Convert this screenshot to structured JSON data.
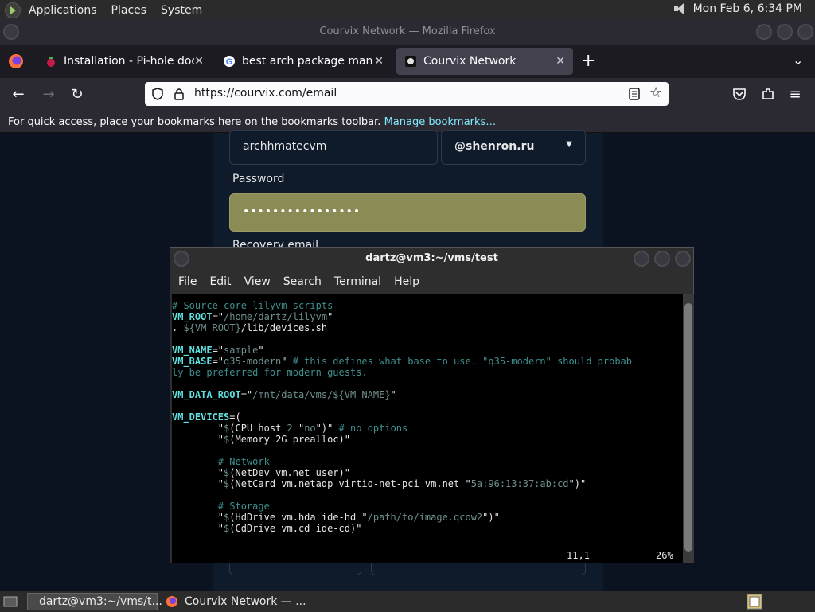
{
  "top_panel": {
    "menus": [
      "Applications",
      "Places",
      "System"
    ],
    "clock": "Mon Feb  6,  6:34 PM"
  },
  "firefox": {
    "window_title": "Courvix Network — Mozilla Firefox",
    "tabs": [
      {
        "title": "Installation - Pi-hole documentation",
        "favicon": "raspberry-icon",
        "color": "#c51a4a"
      },
      {
        "title": "best arch package manager",
        "favicon": "google-icon",
        "color": "#4285f4"
      },
      {
        "title": "Courvix Network",
        "favicon": "courvix-icon",
        "color": "#e0e0e0"
      }
    ],
    "url": "https://courvix.com/email",
    "bookmarks_text": "For quick access, place your bookmarks here on the bookmarks toolbar.",
    "bookmarks_link": "Manage bookmarks…"
  },
  "page": {
    "username_value": "archhmatecvm",
    "domain_value": "@shenron.ru",
    "password_label": "Password",
    "password_value": "••••••••••••••••",
    "recovery_label": "Recovery email"
  },
  "terminal": {
    "title": "dartz@vm3:~/vms/test",
    "menu": [
      "File",
      "Edit",
      "View",
      "Search",
      "Terminal",
      "Help"
    ],
    "position": "11,1",
    "percent": "26%"
  },
  "bottom_panel": {
    "tasks": [
      "dartz@vm3:~/vms/t...",
      "Courvix Network — ..."
    ]
  },
  "colors": {
    "accent": "#80ebff",
    "password_fill": "#8b8b55"
  }
}
